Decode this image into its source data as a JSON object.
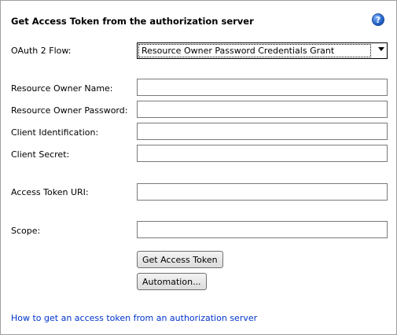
{
  "panel": {
    "title": "Get Access Token from the authorization server",
    "help_icon": "help-question-icon"
  },
  "flow": {
    "label": "OAuth 2 Flow:",
    "selected": "Resource Owner Password Credentials Grant"
  },
  "fields": {
    "owner_name_label": "Resource Owner Name:",
    "owner_name_value": "",
    "owner_password_label": "Resource Owner Password:",
    "owner_password_value": "",
    "client_id_label": "Client Identification:",
    "client_id_value": "",
    "client_secret_label": "Client Secret:",
    "client_secret_value": "",
    "token_uri_label": "Access Token URI:",
    "token_uri_value": "",
    "scope_label": "Scope:",
    "scope_value": ""
  },
  "buttons": {
    "get_token": "Get Access Token",
    "automation": "Automation..."
  },
  "help_link": "How to get an access token from an authorization server"
}
